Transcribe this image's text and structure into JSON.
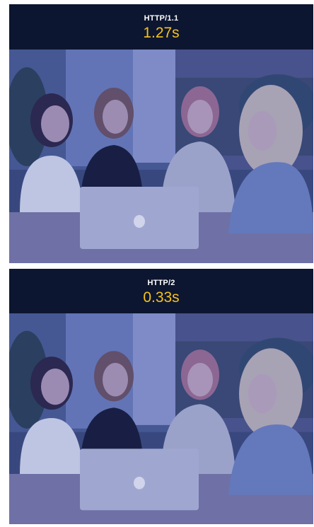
{
  "panels": [
    {
      "protocol": "HTTP/1.1",
      "load_time": "1.27s",
      "image": "photo-four-women-around-laptop"
    },
    {
      "protocol": "HTTP/2",
      "load_time": "0.33s",
      "image": "photo-four-women-around-laptop"
    }
  ],
  "colors": {
    "header_bg": "#0d1630",
    "timing_text": "#f6c21a",
    "protocol_text": "#ffffff",
    "photo_tint": "#5a66b8"
  }
}
